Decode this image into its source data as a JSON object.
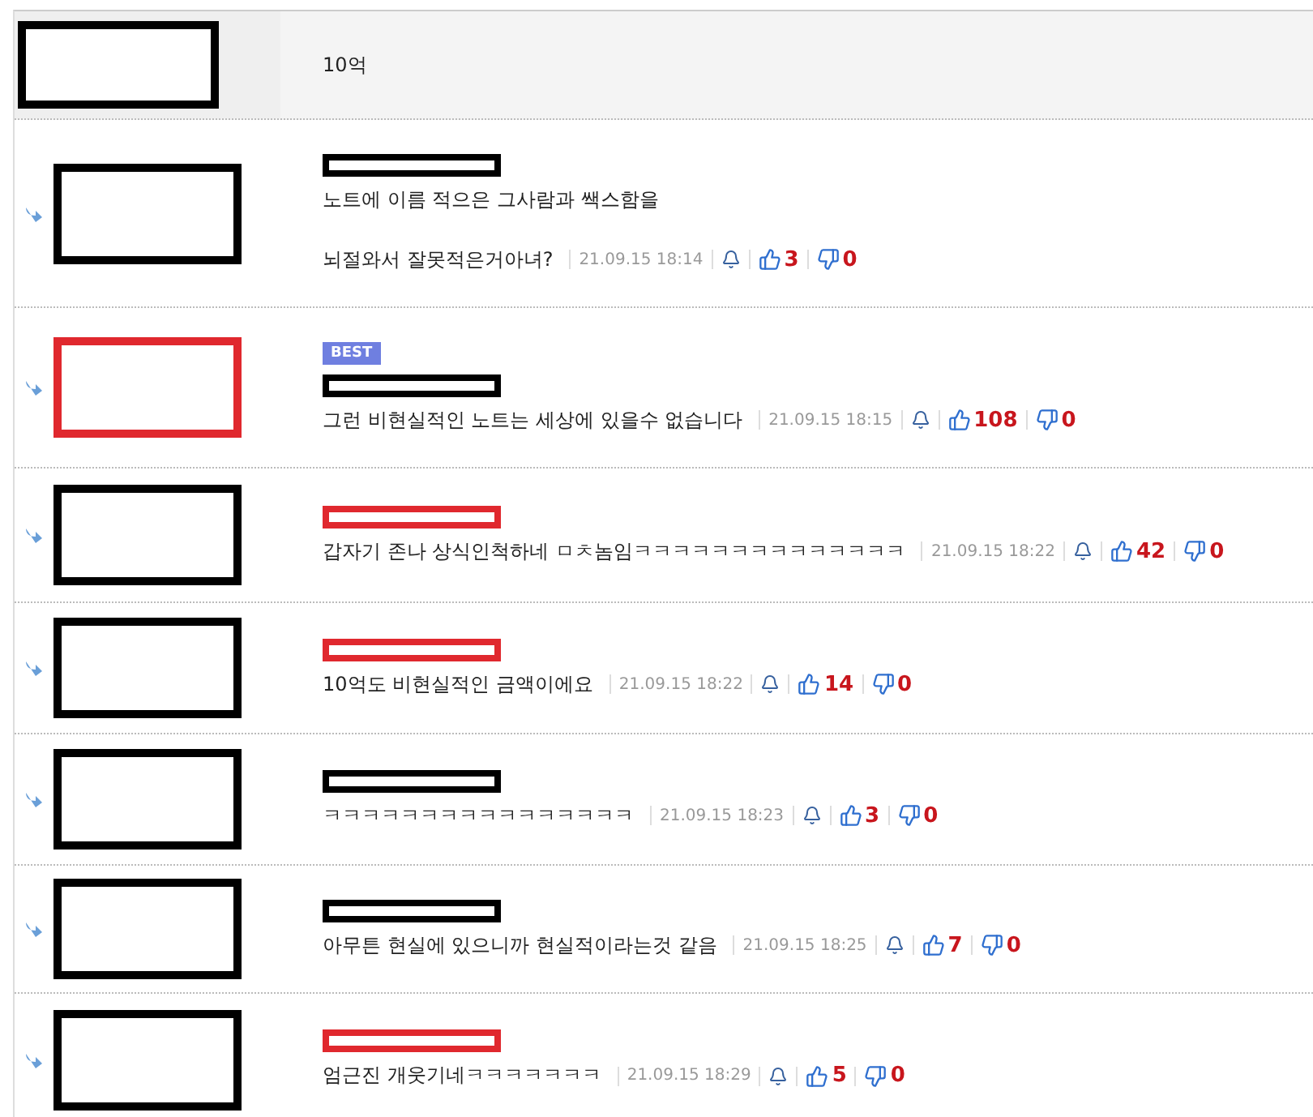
{
  "post": {
    "avatar_mark": {
      "color": "#000000"
    },
    "text": "10억"
  },
  "comments": [
    {
      "best": false,
      "avatar_mark": {
        "color": "#000000"
      },
      "name_mark": {
        "color": "#000000"
      },
      "lines": [
        "노트에 이름 적으은 그사람과 쌕스함을",
        "뇌절와서 잘못적은거아녀?"
      ],
      "date": "21.09.15 18:14",
      "up": "3",
      "down": "0"
    },
    {
      "best": true,
      "badge": "BEST",
      "avatar_mark": {
        "color": "#e0282e"
      },
      "name_mark": {
        "color": "#000000"
      },
      "lines": [
        "그런 비현실적인 노트는 세상에 있을수 없습니다"
      ],
      "date": "21.09.15 18:15",
      "up": "108",
      "down": "0"
    },
    {
      "best": false,
      "avatar_mark": {
        "color": "#000000"
      },
      "name_mark": {
        "color": "#e0282e"
      },
      "lines": [
        "갑자기 존나 상식인척하네 ㅁㅊ놈임ㅋㅋㅋㅋㅋㅋㅋㅋㅋㅋㅋㅋㅋㅋ"
      ],
      "date": "21.09.15 18:22",
      "up": "42",
      "down": "0"
    },
    {
      "best": false,
      "avatar_mark": {
        "color": "#000000"
      },
      "name_mark": {
        "color": "#e0282e"
      },
      "lines": [
        "10억도 비현실적인 금액이에요"
      ],
      "date": "21.09.15 18:22",
      "up": "14",
      "down": "0"
    },
    {
      "best": false,
      "avatar_mark": {
        "color": "#000000"
      },
      "name_mark": {
        "color": "#000000"
      },
      "lines": [
        "ㅋㅋㅋㅋㅋㅋㅋㅋㅋㅋㅋㅋㅋㅋㅋㅋ"
      ],
      "date": "21.09.15 18:23",
      "up": "3",
      "down": "0"
    },
    {
      "best": false,
      "avatar_mark": {
        "color": "#000000"
      },
      "name_mark": {
        "color": "#000000"
      },
      "lines": [
        "아무튼 현실에 있으니까 현실적이라는것 같음"
      ],
      "date": "21.09.15 18:25",
      "up": "7",
      "down": "0"
    },
    {
      "best": false,
      "avatar_mark": {
        "color": "#000000"
      },
      "name_mark": {
        "color": "#e0282e"
      },
      "lines": [
        "엄근진 개웃기네ㅋㅋㅋㅋㅋㅋㅋ"
      ],
      "date": "21.09.15 18:29",
      "up": "5",
      "down": "0"
    }
  ]
}
